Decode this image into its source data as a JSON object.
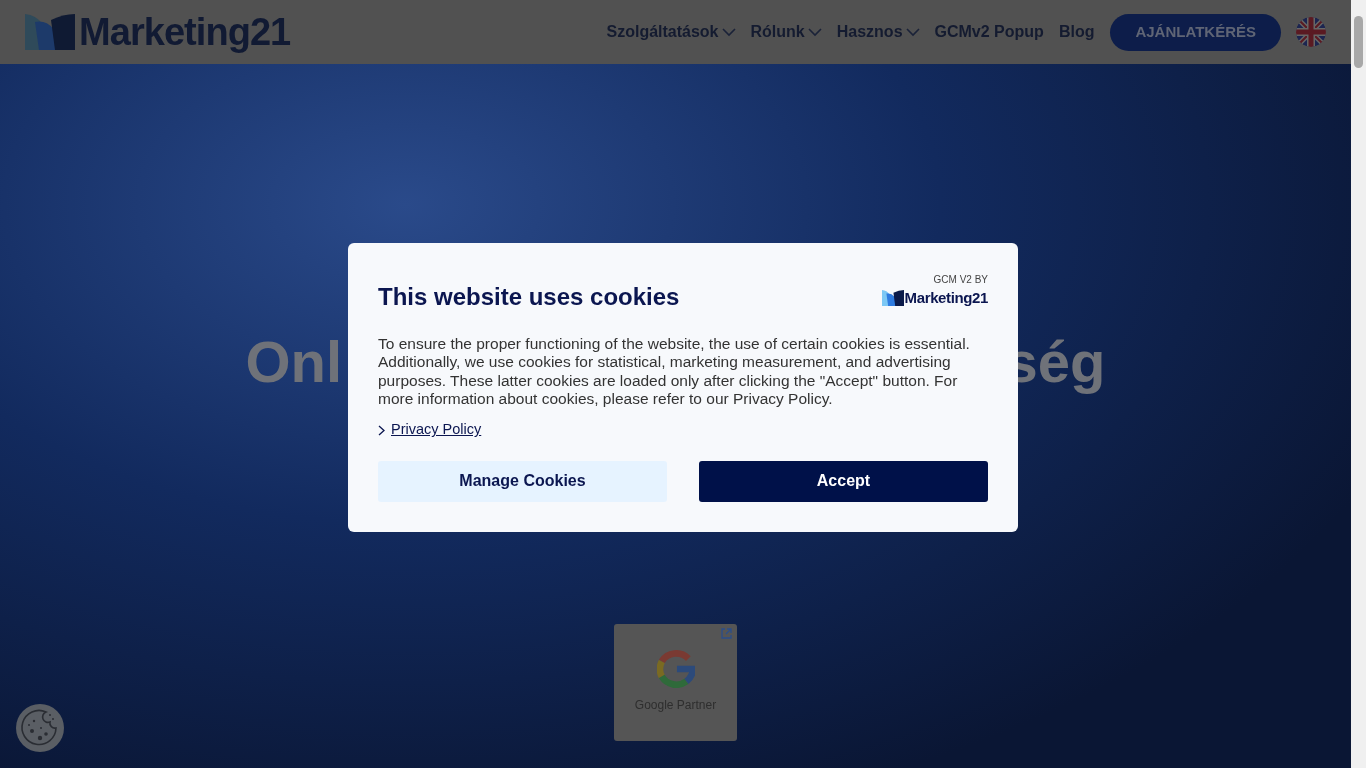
{
  "header": {
    "logo": "Marketing21",
    "nav": [
      {
        "label": "Szolgáltatások",
        "dropdown": true
      },
      {
        "label": "Rólunk",
        "dropdown": true
      },
      {
        "label": "Hasznos",
        "dropdown": true
      },
      {
        "label": "GCMv2 Popup",
        "dropdown": false
      },
      {
        "label": "Blog",
        "dropdown": false
      }
    ],
    "cta": "AJÁNLATKÉRÉS"
  },
  "hero": {
    "heading_left": "Onl",
    "heading_right": "ség",
    "badge": {
      "label": "Google Partner"
    }
  },
  "cookie_dialog": {
    "title": "This website uses cookies",
    "brand_caption": "GCM V2 BY",
    "brand": "Marketing21",
    "body": "To ensure the proper functioning of the website, the use of certain cookies is essential. Additionally, we use cookies for statistical, marketing measurement, and advertising purposes. These latter cookies are loaded only after clicking the \"Accept\" button. For more information about cookies, please refer to our Privacy Policy.",
    "link": "Privacy Policy",
    "buttons": [
      {
        "label": "Manage Cookies",
        "kind": "secondary"
      },
      {
        "label": "Accept",
        "kind": "primary"
      }
    ]
  }
}
